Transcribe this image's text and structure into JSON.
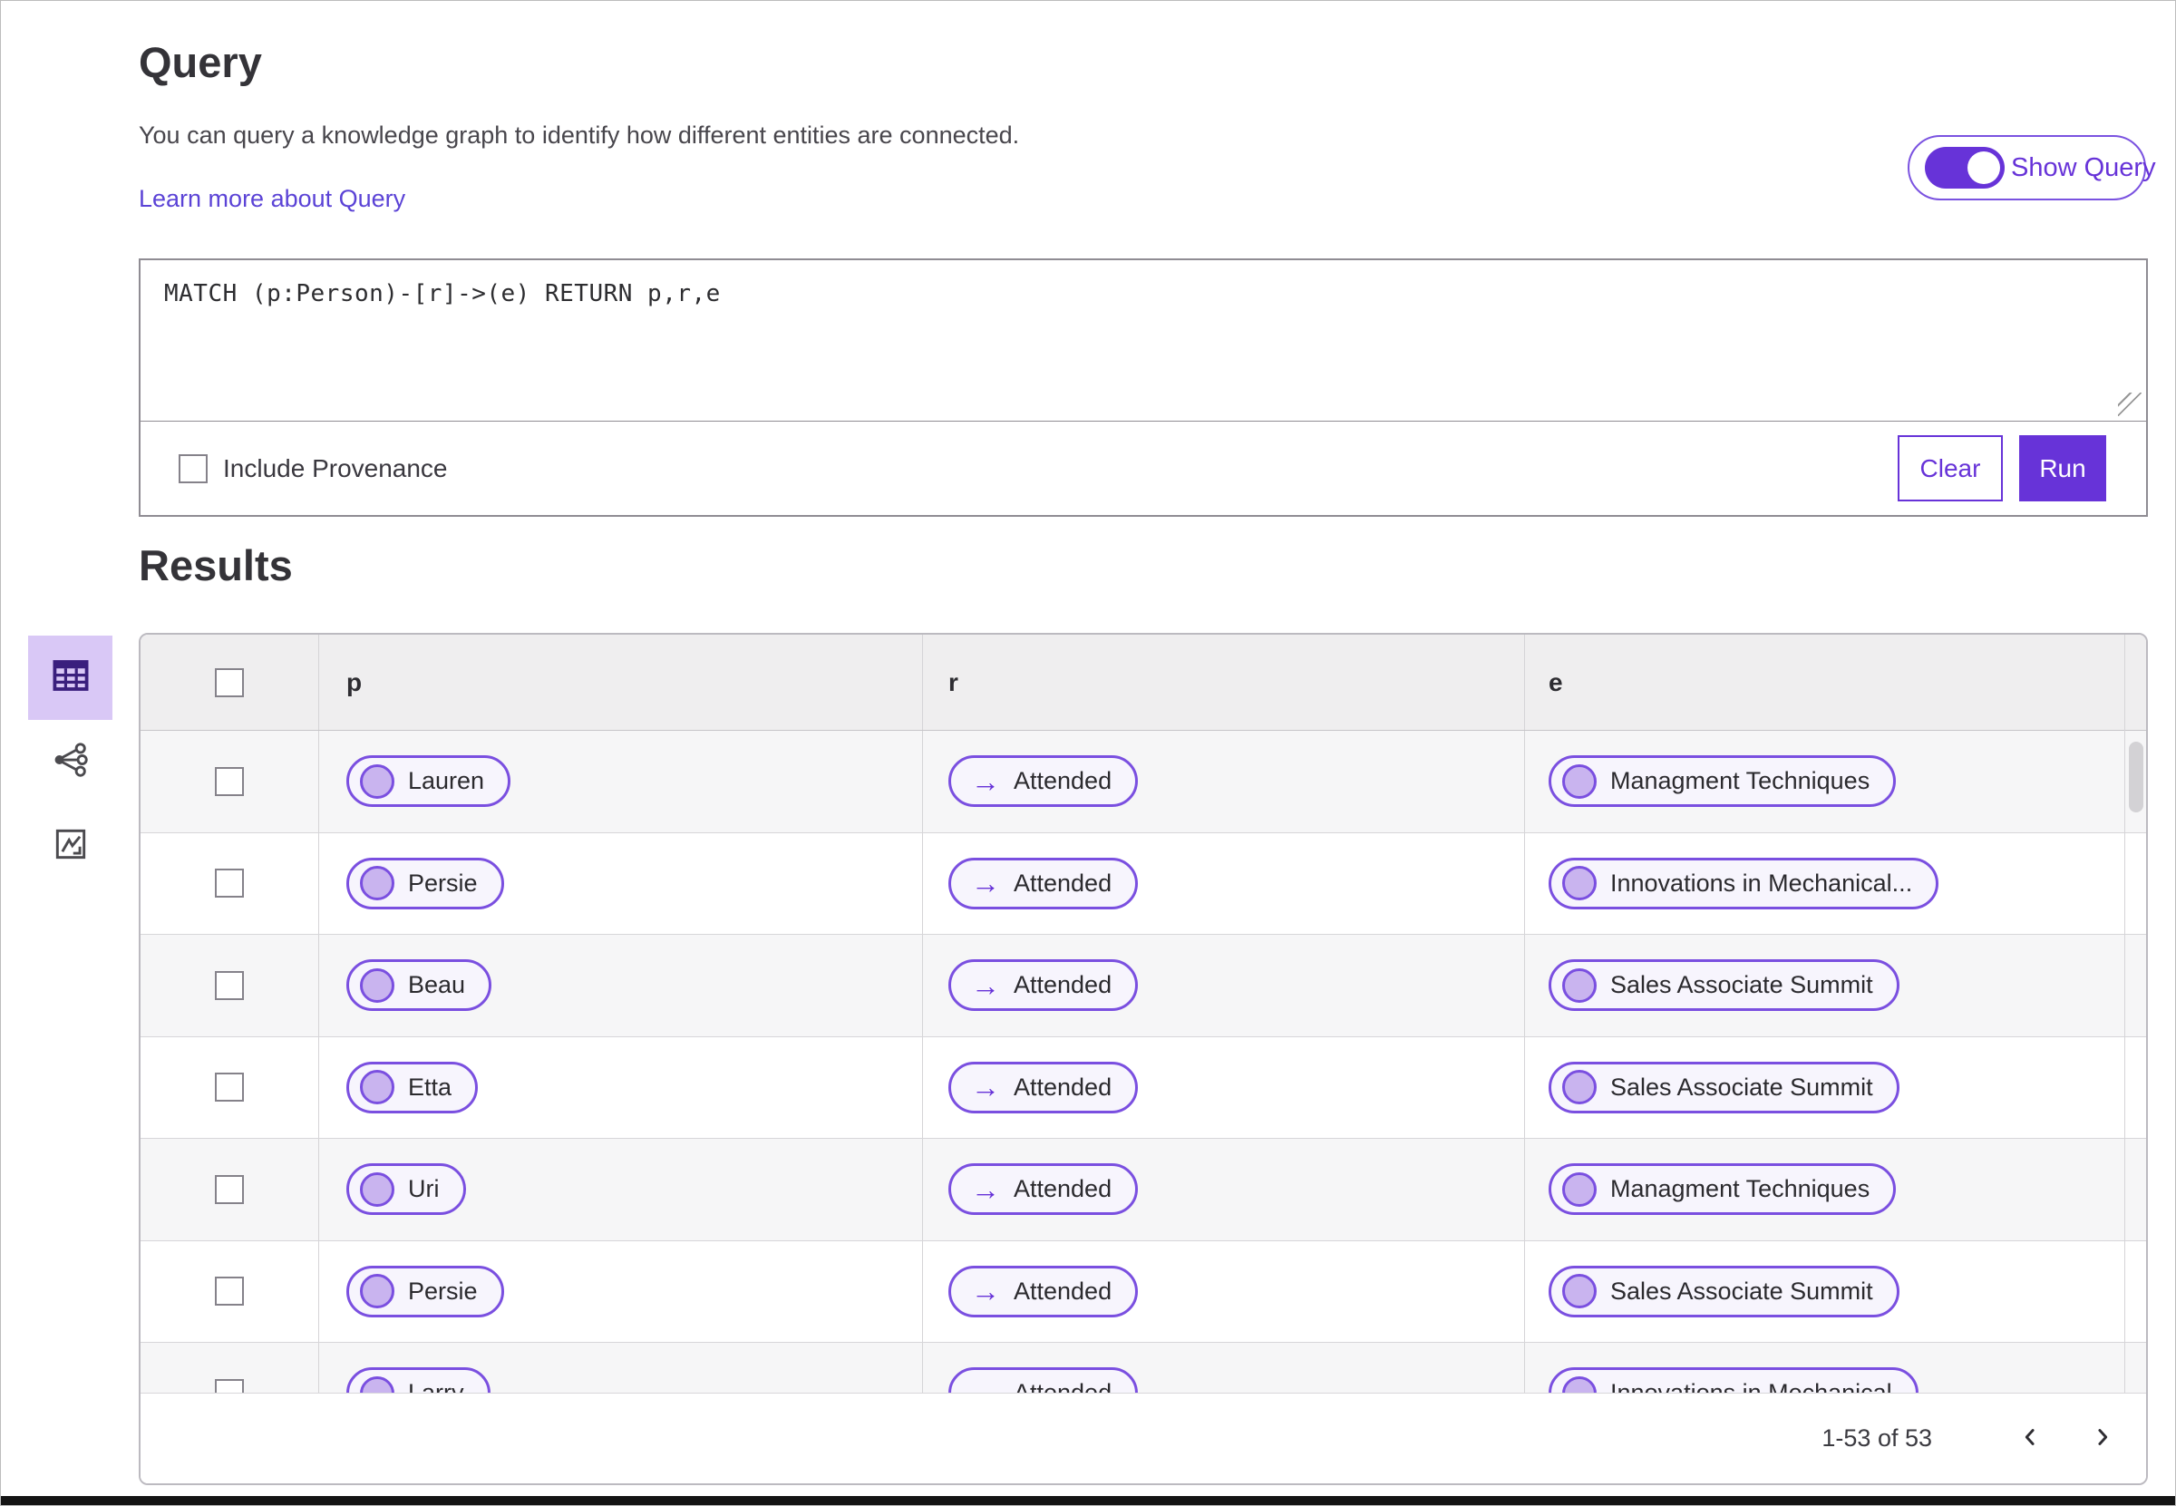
{
  "page": {
    "title": "Query",
    "description": "You can query a knowledge graph to identify how different entities are connected.",
    "learn_more_link": "Learn more about Query",
    "show_query_toggle": {
      "label": "Show Query",
      "state": "on"
    }
  },
  "query_editor": {
    "query_text": "MATCH (p:Person)-[r]->(e) RETURN p,r,e",
    "include_provenance": {
      "label": "Include Provenance",
      "checked": false
    },
    "clear_button": "Clear",
    "run_button": "Run"
  },
  "results": {
    "title": "Results",
    "views": [
      {
        "name": "table-view",
        "icon": "table-icon",
        "selected": true
      },
      {
        "name": "network-view",
        "icon": "network-icon",
        "selected": false
      },
      {
        "name": "chart-view",
        "icon": "chart-icon",
        "selected": false
      }
    ],
    "table": {
      "columns": [
        "p",
        "r",
        "e"
      ],
      "rows": [
        {
          "p": "Lauren",
          "r": "Attended",
          "e": "Managment Techniques"
        },
        {
          "p": "Persie",
          "r": "Attended",
          "e": "Innovations in Mechanical..."
        },
        {
          "p": "Beau",
          "r": "Attended",
          "e": "Sales Associate Summit"
        },
        {
          "p": "Etta",
          "r": "Attended",
          "e": "Sales Associate Summit"
        },
        {
          "p": "Uri",
          "r": "Attended",
          "e": "Managment Techniques"
        },
        {
          "p": "Persie",
          "r": "Attended",
          "e": "Sales Associate Summit"
        },
        {
          "p": "Larry",
          "r": "Attended",
          "e": "Innovations in Mechanical"
        }
      ]
    },
    "pagination": {
      "range_label": "1-53 of 53",
      "prev_icon": "chevron-left-icon",
      "next_icon": "chevron-right-icon"
    }
  },
  "colors": {
    "accent": "#6733d8",
    "accent_border": "#7a52e0",
    "pill_bg": "#f7f5fd",
    "pill_circle": "#c9b4ef",
    "selected_tile_bg": "#d9c8f6",
    "table_header_bg": "#efeeef",
    "row_alt_bg": "#f6f6f7",
    "link": "#5b43d6"
  }
}
